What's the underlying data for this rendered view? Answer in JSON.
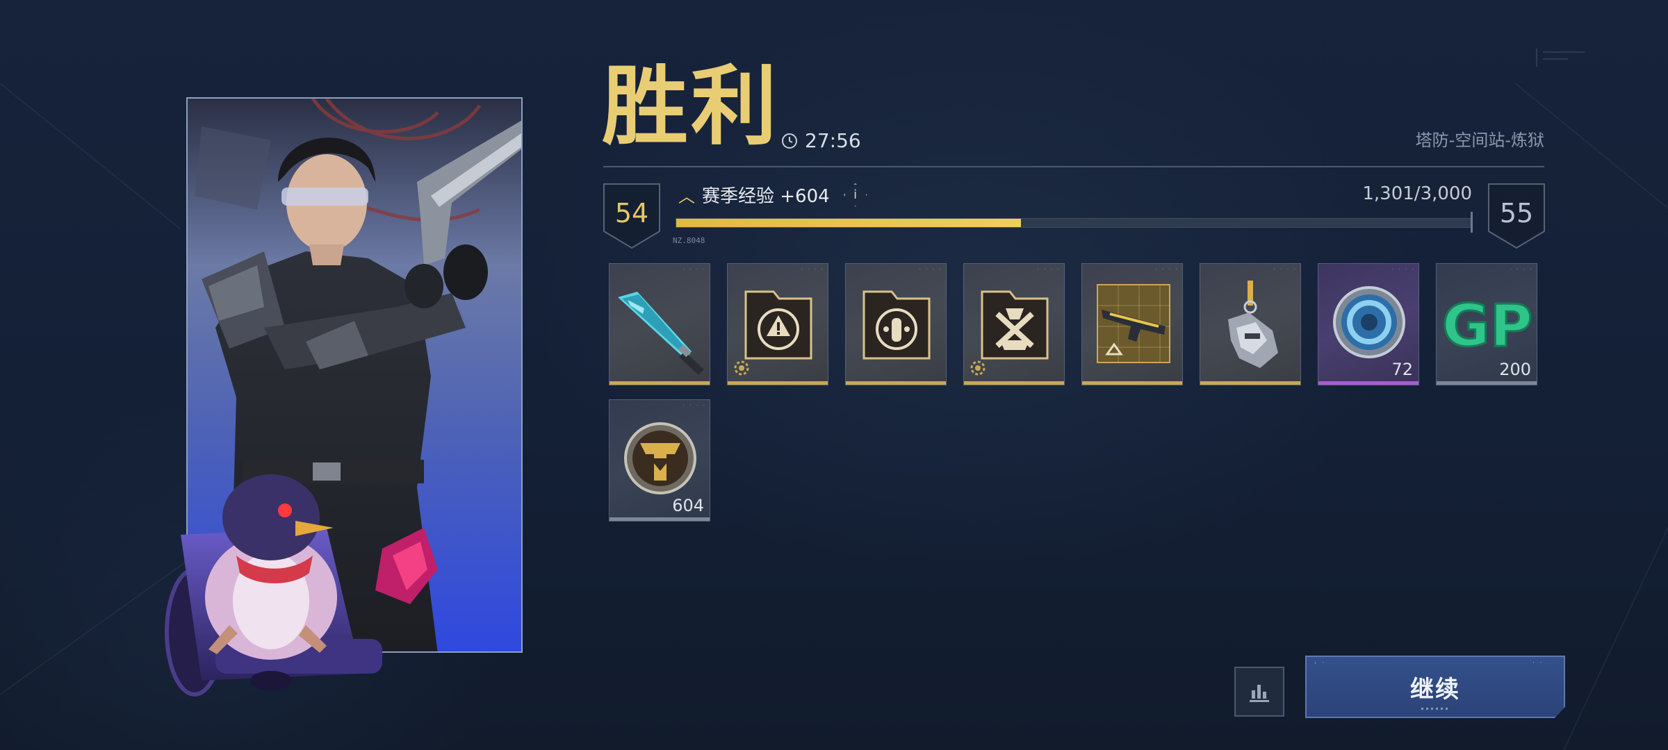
{
  "result": {
    "title": "胜利",
    "time": "27:56",
    "map_name": "塔防-空间站-炼狱"
  },
  "level": {
    "current": "54",
    "next": "55",
    "exp_label": "赛季经验 +604",
    "exp_progress_text": "1,301/3,000",
    "exp_progress_fraction": 0.434,
    "bar_tag": "NZ.8048"
  },
  "rewards": [
    {
      "icon": "combat-knife-icon",
      "rarity": "gold",
      "quantity": ""
    },
    {
      "icon": "warning-folder-icon",
      "rarity": "gold",
      "quantity": "",
      "gear_badge": true
    },
    {
      "icon": "bullet-folder-icon",
      "rarity": "gold",
      "quantity": ""
    },
    {
      "icon": "crossed-weapons-folder-icon",
      "rarity": "gold",
      "quantity": "",
      "gear_badge": true
    },
    {
      "icon": "weapon-blueprint-icon",
      "rarity": "gold",
      "quantity": ""
    },
    {
      "icon": "weapon-charm-icon",
      "rarity": "gold",
      "quantity": ""
    },
    {
      "icon": "blue-coin-icon",
      "rarity": "purple",
      "quantity": "72"
    },
    {
      "icon": "gp-currency-icon",
      "rarity": "gray",
      "quantity": "200"
    },
    {
      "icon": "exp-medal-icon",
      "rarity": "gray",
      "quantity": "604"
    }
  ],
  "gp_text": "GP",
  "actions": {
    "continue_label": "继续",
    "stats_icon": "bar-chart-icon"
  },
  "colors": {
    "title_gold": "#e9cd74",
    "exp_bar": "#f0cf5c",
    "continue_bg": "#2f4a80"
  }
}
